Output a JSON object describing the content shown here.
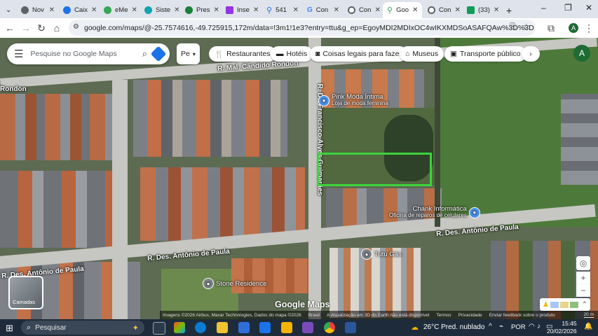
{
  "tabs": [
    {
      "label": "Nov",
      "color": "#5f6368"
    },
    {
      "label": "Caix",
      "color": "#1a73e8"
    },
    {
      "label": "eMe",
      "color": "#34a853"
    },
    {
      "label": "Siste",
      "color": "#12a4af"
    },
    {
      "label": "Pres",
      "color": "#188038"
    },
    {
      "label": "Inse",
      "color": "#9334e6"
    },
    {
      "label": "541",
      "color": "#1a73e8"
    },
    {
      "label": "Con",
      "color": "#4285f4"
    },
    {
      "label": "Con",
      "color": "#5f6368"
    },
    {
      "label": "Goo",
      "color": "#34a853"
    },
    {
      "label": "Con",
      "color": "#5f6368"
    },
    {
      "label": "(33)",
      "color": "#0f9d58"
    }
  ],
  "new_tab": "+",
  "window": {
    "minimize": "–",
    "restore": "❐",
    "close": "✕"
  },
  "toolbar": {
    "url": "google.com/maps/@-25.7574616,-49.725915,172m/data=!3m1!1e3?entry=ttu&g_ep=EgoyMDI2MDIxOC4wIKXMDSoASAFQAw%3D%3D",
    "profile": "A"
  },
  "map": {
    "search_placeholder": "Pesquise no Google Maps",
    "partial_chip": "Pe",
    "chips": [
      {
        "label": "Restaurantes",
        "icon": "fork-knife-icon"
      },
      {
        "label": "Hotéis",
        "icon": "bed-icon"
      },
      {
        "label": "Coisas legais para fazer",
        "icon": "camera-icon"
      },
      {
        "label": "Museus",
        "icon": "museum-icon"
      },
      {
        "label": "Transporte público",
        "icon": "train-icon"
      }
    ],
    "account_avatar": "A",
    "streets": {
      "candido_rondon_1": "R. Mal. Cândido Rondon",
      "candido_rondon_2": "Rondon",
      "francisco": "R. Dr. Francisco Alves Guimarães",
      "antonio_right": "R. Des. Antônio de Paula",
      "antonio_mid": "R. Des. Antônio de Paula",
      "antonio_left": "R. Des. Antônio de Paula"
    },
    "pois": {
      "pink_moda": "Pink Moda Íntima",
      "pink_moda_sub": "Loja de moda feminina",
      "chank": "Chank Informática",
      "chank_sub": "Oficina de reparos de celulares",
      "tutu": "Tutu Gás",
      "stone": "Stone Residence"
    },
    "layers_label": "Camadas",
    "google_logo": "Google Maps",
    "attribution": "Imagens ©2026 Airbus, Maxar Technologies, Dados do mapa ©2026",
    "attribution_country": "Brasil",
    "footer_links": [
      "A visualização em 3D do Earth não está disponível",
      "Termos",
      "Privacidade",
      "Enviar feedback sobre o produto"
    ],
    "scale": "20 m"
  },
  "taskbar": {
    "search_placeholder": "Pesquisar",
    "weather": "26°C  Pred. nublado",
    "language": "POR",
    "time": "15:45",
    "date": "20/02/2026"
  }
}
